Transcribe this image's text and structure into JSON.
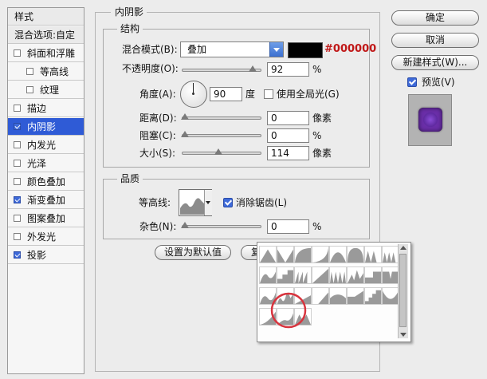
{
  "style_list": {
    "header": "样式",
    "blend_options": "混合选项:自定",
    "items": [
      {
        "label": "斜面和浮雕",
        "checked": false,
        "indent": false,
        "selected": false
      },
      {
        "label": "等高线",
        "checked": false,
        "indent": true,
        "selected": false
      },
      {
        "label": "纹理",
        "checked": false,
        "indent": true,
        "selected": false
      },
      {
        "label": "描边",
        "checked": false,
        "indent": false,
        "selected": false
      },
      {
        "label": "内阴影",
        "checked": true,
        "indent": false,
        "selected": true
      },
      {
        "label": "内发光",
        "checked": false,
        "indent": false,
        "selected": false
      },
      {
        "label": "光泽",
        "checked": false,
        "indent": false,
        "selected": false
      },
      {
        "label": "颜色叠加",
        "checked": false,
        "indent": false,
        "selected": false
      },
      {
        "label": "渐变叠加",
        "checked": true,
        "indent": false,
        "selected": false
      },
      {
        "label": "图案叠加",
        "checked": false,
        "indent": false,
        "selected": false
      },
      {
        "label": "外发光",
        "checked": false,
        "indent": false,
        "selected": false
      },
      {
        "label": "投影",
        "checked": true,
        "indent": false,
        "selected": false
      }
    ]
  },
  "inner_shadow": {
    "title": "内阴影",
    "structure": {
      "title": "结构",
      "blend_mode_label": "混合模式(B):",
      "blend_mode_value": "叠加",
      "color_hex_label": "#000000",
      "shadow_color": "#000000",
      "opacity_label": "不透明度(O):",
      "opacity_value": "92",
      "opacity_unit": "%",
      "opacity_fraction": 0.92,
      "angle_label": "角度(A):",
      "angle_value": "90",
      "angle_unit": "度",
      "global_light_label": "使用全局光(G)",
      "global_light_checked": false,
      "distance_label": "距离(D):",
      "distance_value": "0",
      "distance_unit": "像素",
      "distance_fraction": 0.0,
      "choke_label": "阻塞(C):",
      "choke_value": "0",
      "choke_unit": "%",
      "choke_fraction": 0.0,
      "size_label": "大小(S):",
      "size_value": "114",
      "size_unit": "像素",
      "size_fraction": 0.46
    },
    "quality": {
      "title": "品质",
      "contour_label": "等高线:",
      "anti_alias_label": "消除锯齿(L)",
      "anti_alias_checked": true,
      "noise_label": "杂色(N):",
      "noise_value": "0",
      "noise_unit": "%",
      "noise_fraction": 0.0
    },
    "set_default_button": "设置为默认值",
    "reset_default_button": "复"
  },
  "buttons": {
    "ok": "确定",
    "cancel": "取消",
    "new_style": "新建样式(W)...",
    "preview_label": "预览(V)",
    "preview_checked": true
  },
  "colors": {
    "selection_blue": "#2f5bd6",
    "hex_label_red": "#c01818",
    "preview_purple": "#6a2ea8",
    "highlight_circle": "#d8343e"
  },
  "contour_presets": {
    "icons": [
      "cone-contour-icon",
      "cone-inverted-contour-icon",
      "cove-deep-contour-icon",
      "cove-shallow-contour-icon",
      "gaussian-contour-icon",
      "half-round-contour-icon",
      "ring-contour-icon",
      "ring-double-contour-icon",
      "rolling-slope-contour-icon",
      "rounded-steps-contour-icon",
      "sawtooth-contour-icon",
      "linear-contour-icon",
      "ring-triple-contour-icon",
      "peaks-contour-icon",
      "steps-contour-icon",
      "notch-contour-icon",
      "wave-contour-icon",
      "ripple-contour-icon",
      "ramp-contour-icon",
      "slope-contour-icon",
      "bump-contour-icon",
      "ledge-contour-icon",
      "stairs-contour-icon",
      "valley-contour-icon",
      "rise-contour-icon",
      "slant-contour-icon",
      "dip-contour-icon"
    ],
    "highlighted_index": 25
  }
}
